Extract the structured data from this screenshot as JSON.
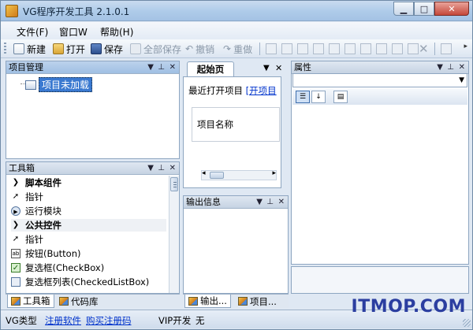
{
  "window": {
    "title": "VG程序开发工具 2.1.0.1"
  },
  "menu": {
    "items": [
      "文件(F)",
      "窗口W",
      "帮助(H)"
    ]
  },
  "toolbar": {
    "new_label": "新建",
    "open_label": "打开",
    "save_label": "保存",
    "save_all_label": "全部保存",
    "undo_label": "撤销",
    "redo_label": "重做"
  },
  "project_panel": {
    "title": "项目管理",
    "root_label": "项目未加载"
  },
  "toolbox": {
    "title": "工具箱",
    "items": [
      {
        "text": "脚本组件",
        "kind": "category",
        "icon": "chevron-right-icon"
      },
      {
        "text": "指针",
        "kind": "item",
        "icon": "pointer-icon"
      },
      {
        "text": "运行模块",
        "kind": "item",
        "icon": "run-icon"
      },
      {
        "text": "公共控件",
        "kind": "category",
        "icon": "chevron-right-icon"
      },
      {
        "text": "指针",
        "kind": "item",
        "icon": "pointer-icon"
      },
      {
        "text": "按钮(Button)",
        "kind": "item",
        "icon": "button-icon"
      },
      {
        "text": "复选框(CheckBox)",
        "kind": "item",
        "icon": "checkbox-icon"
      },
      {
        "text": "复选框列表(CheckedListBox)",
        "kind": "item",
        "icon": "list-icon"
      }
    ]
  },
  "left_tabs": {
    "toolbox": "工具箱",
    "code": "代码库"
  },
  "document": {
    "tab_label": "起始页",
    "recent_label": "最近打开项目",
    "open_project_link": "[开项目",
    "project_name_label": "项目名称"
  },
  "output_panel": {
    "title": "输出信息",
    "tab_output": "输出...",
    "tab_project": "项目..."
  },
  "properties_panel": {
    "title": "属性"
  },
  "status": {
    "vg_type": "VG类型",
    "register_link": "注册软件",
    "buy_link": "购买注册码",
    "vip_label": "VIP开发",
    "vip_value": "无"
  },
  "watermark": "ITMOP.COM"
}
